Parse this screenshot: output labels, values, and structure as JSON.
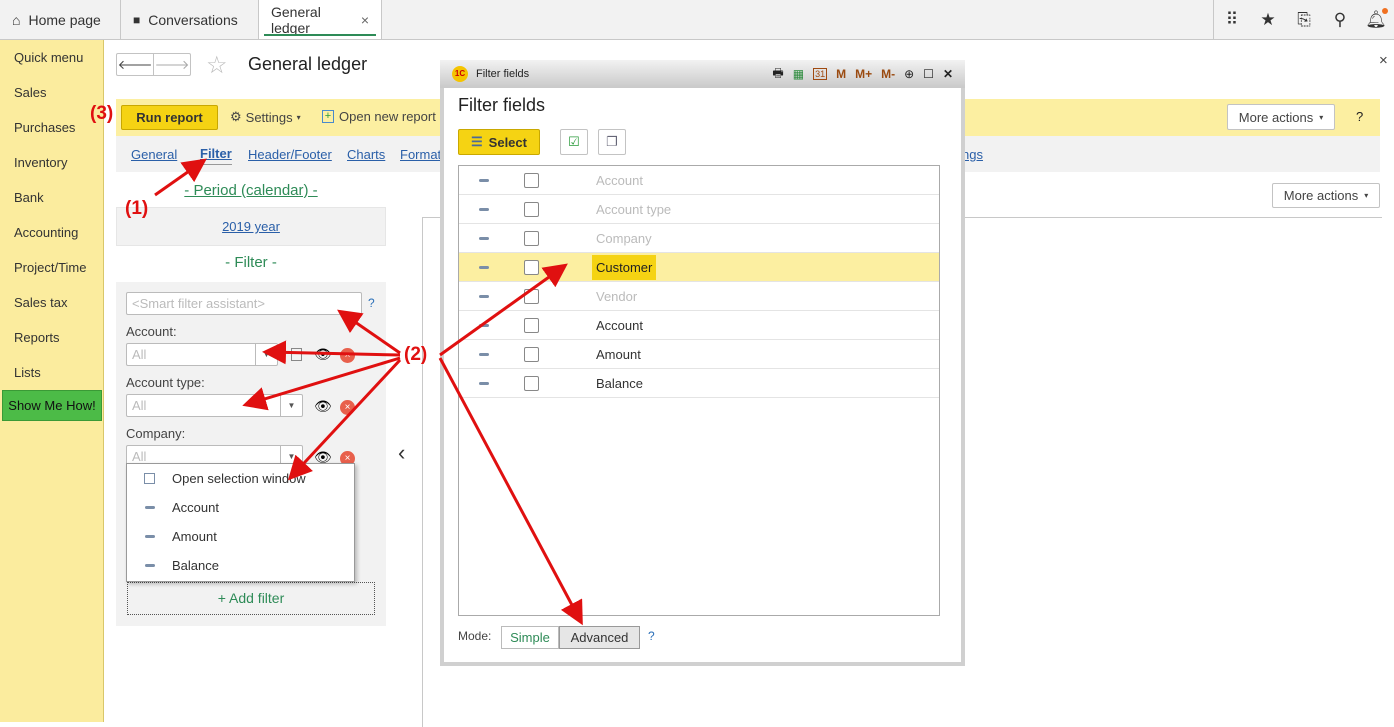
{
  "tabs": [
    {
      "label": "Home page",
      "icon": "home-icon"
    },
    {
      "label": "Conversations",
      "icon": "conversations-icon"
    },
    {
      "label": "General ledger",
      "icon": "close-icon"
    }
  ],
  "top_icons": [
    "apps-grid-icon",
    "star-icon",
    "history-icon",
    "search-icon",
    "bell-icon"
  ],
  "sidebar": {
    "items": [
      "Quick menu",
      "Sales",
      "Purchases",
      "Inventory",
      "Bank",
      "Accounting",
      "Project/Time",
      "Sales tax",
      "Reports",
      "Lists"
    ],
    "show_me": "Show Me How!"
  },
  "page": {
    "title": "General ledger",
    "close": "×"
  },
  "toolbar": {
    "run_report": "Run report",
    "settings": "Settings",
    "open_new_report": "Open new report",
    "more_actions": "More actions",
    "help": "?"
  },
  "settings_tabs": [
    "General",
    "Filter",
    "Header/Footer",
    "Charts",
    "Format"
  ],
  "settings_tab_tail": "ngs",
  "period": {
    "heading": "- Period (calendar) -",
    "value": "2019 year"
  },
  "filter": {
    "heading": "- Filter -",
    "smart_placeholder": "<Smart filter assistant>",
    "help": "?",
    "fields": [
      {
        "label": "Account:",
        "value": "All"
      },
      {
        "label": "Account type:",
        "value": "All"
      },
      {
        "label": "Company:",
        "value": "All"
      }
    ],
    "add_filter": "+ Add filter",
    "dropdown": [
      "Open selection window",
      "Account",
      "Amount",
      "Balance"
    ]
  },
  "report": {
    "more_actions": "More actions",
    "collapse": "‹"
  },
  "modal": {
    "window_title": "Filter fields",
    "title_icons": [
      "print-icon",
      "calculator-icon",
      "calendar-icon"
    ],
    "title_buttons": [
      "M",
      "M+",
      "M-"
    ],
    "heading": "Filter fields",
    "select": "Select",
    "rows": [
      {
        "label": "Account",
        "enabled": false
      },
      {
        "label": "Account type",
        "enabled": false
      },
      {
        "label": "Company",
        "enabled": false
      },
      {
        "label": "Customer",
        "enabled": true,
        "selected": true
      },
      {
        "label": "Vendor",
        "enabled": false
      },
      {
        "label": "Account",
        "enabled": true
      },
      {
        "label": "Amount",
        "enabled": true
      },
      {
        "label": "Balance",
        "enabled": true
      }
    ],
    "mode_label": "Mode:",
    "mode_simple": "Simple",
    "mode_advanced": "Advanced",
    "help": "?"
  },
  "annotations": {
    "a1": "(1)",
    "a2": "(2)",
    "a3": "(3)"
  },
  "colors": {
    "accent_yellow": "#f5d313",
    "sidebar": "#fbec9e",
    "green": "#2e8b57",
    "annotation": "#e01010"
  }
}
